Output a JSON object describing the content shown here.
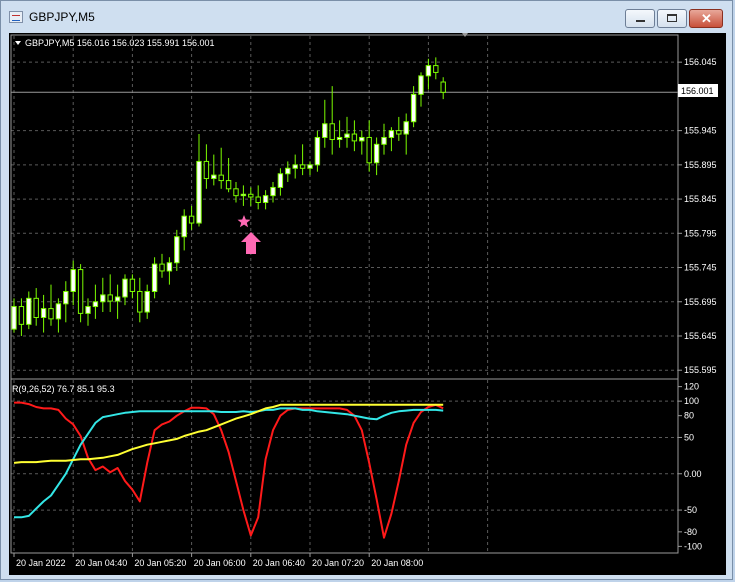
{
  "window": {
    "title": "GBPJPY,M5",
    "minimize_glyph": "–",
    "maximize_glyph": "□",
    "close_glyph": "✕"
  },
  "colors": {
    "background": "#000000",
    "grid": "#5a5a5a",
    "candle": "#7cfc00",
    "candle_body": "#ffffff",
    "line_red": "#ff1a1a",
    "line_cyan": "#33e6e6",
    "line_yellow": "#ffff33",
    "signal": "#ff69b4"
  },
  "price_panel": {
    "header": "GBPJPY,M5  156.016 156.023 155.991 156.001",
    "current_price_label": "156.001"
  },
  "indicator_panel": {
    "header": "R(9,26,52) 76.7 85.1 95.3"
  },
  "icons": {
    "signal_star": "star-icon",
    "buy_arrow": "arrow-up-icon",
    "menu": "triangle-down-icon"
  },
  "chart_data": [
    {
      "type": "candlestick",
      "title": "GBPJPY,M5",
      "ohlc_readout": [
        156.016,
        156.023,
        155.991,
        156.001
      ],
      "ylim": [
        155.588,
        156.073
      ],
      "yticks": [
        155.595,
        155.645,
        155.695,
        155.745,
        155.795,
        155.845,
        155.895,
        155.945,
        156.045
      ],
      "ytick_labels": [
        "155.595",
        "155.645",
        "155.695",
        "155.745",
        "155.795",
        "155.845",
        "155.895",
        "155.945",
        "156.045"
      ],
      "current_price": 156.001,
      "grid": true,
      "candles": [
        [
          155.655,
          155.7,
          155.65,
          155.688
        ],
        [
          155.688,
          155.7,
          155.645,
          155.662
        ],
        [
          155.662,
          155.71,
          155.655,
          155.7
        ],
        [
          155.7,
          155.715,
          155.66,
          155.672
        ],
        [
          155.672,
          155.705,
          155.65,
          155.685
        ],
        [
          155.685,
          155.72,
          155.66,
          155.67
        ],
        [
          155.67,
          155.7,
          155.65,
          155.692
        ],
        [
          155.692,
          155.725,
          155.665,
          155.71
        ],
        [
          155.71,
          155.755,
          155.69,
          155.742
        ],
        [
          155.742,
          155.75,
          155.665,
          155.678
        ],
        [
          155.678,
          155.7,
          155.66,
          155.688
        ],
        [
          155.688,
          155.72,
          155.67,
          155.695
        ],
        [
          155.695,
          155.73,
          155.68,
          155.705
        ],
        [
          155.705,
          155.735,
          155.68,
          155.696
        ],
        [
          155.696,
          155.72,
          155.67,
          155.702
        ],
        [
          155.702,
          155.735,
          155.69,
          155.728
        ],
        [
          155.728,
          155.735,
          155.7,
          155.71
        ],
        [
          155.71,
          155.73,
          155.665,
          155.68
        ],
        [
          155.68,
          155.72,
          155.67,
          155.71
        ],
        [
          155.71,
          155.76,
          155.7,
          155.75
        ],
        [
          155.75,
          155.765,
          155.73,
          155.74
        ],
        [
          155.74,
          155.76,
          155.72,
          155.752
        ],
        [
          155.752,
          155.8,
          155.74,
          155.79
        ],
        [
          155.79,
          155.83,
          155.77,
          155.82
        ],
        [
          155.82,
          155.835,
          155.8,
          155.81
        ],
        [
          155.81,
          155.94,
          155.805,
          155.9
        ],
        [
          155.9,
          155.925,
          155.86,
          155.875
        ],
        [
          155.875,
          155.91,
          155.865,
          155.88
        ],
        [
          155.88,
          155.92,
          155.86,
          155.872
        ],
        [
          155.872,
          155.905,
          155.855,
          155.86
        ],
        [
          155.86,
          155.87,
          155.84,
          155.85
        ],
        [
          155.85,
          155.865,
          155.835,
          155.852
        ],
        [
          155.852,
          155.862,
          155.835,
          155.848
        ],
        [
          155.848,
          155.865,
          155.83,
          155.84
        ],
        [
          155.84,
          155.858,
          155.83,
          155.85
        ],
        [
          155.85,
          155.87,
          155.84,
          155.862
        ],
        [
          155.862,
          155.89,
          155.85,
          155.882
        ],
        [
          155.882,
          155.9,
          155.87,
          155.89
        ],
        [
          155.89,
          155.91,
          155.875,
          155.895
        ],
        [
          155.895,
          155.925,
          155.88,
          155.89
        ],
        [
          155.89,
          155.9,
          155.88,
          155.895
        ],
        [
          155.895,
          155.945,
          155.885,
          155.935
        ],
        [
          155.935,
          155.99,
          155.92,
          155.955
        ],
        [
          155.955,
          156.01,
          155.91,
          155.932
        ],
        [
          155.932,
          155.96,
          155.92,
          155.935
        ],
        [
          155.935,
          155.965,
          155.92,
          155.94
        ],
        [
          155.94,
          155.96,
          155.915,
          155.93
        ],
        [
          155.93,
          155.945,
          155.91,
          155.935
        ],
        [
          155.935,
          155.96,
          155.885,
          155.898
        ],
        [
          155.898,
          155.935,
          155.88,
          155.925
        ],
        [
          155.925,
          155.955,
          155.91,
          155.935
        ],
        [
          155.935,
          155.95,
          155.915,
          155.945
        ],
        [
          155.945,
          155.965,
          155.93,
          155.94
        ],
        [
          155.94,
          155.97,
          155.91,
          155.958
        ],
        [
          155.958,
          156.01,
          155.95,
          155.998
        ],
        [
          155.998,
          156.03,
          155.98,
          156.025
        ],
        [
          156.025,
          156.05,
          156.005,
          156.04
        ],
        [
          156.04,
          156.052,
          156.02,
          156.03
        ],
        [
          156.016,
          156.023,
          155.991,
          156.001
        ]
      ]
    },
    {
      "type": "line",
      "title": "R(9,26,52)",
      "readout": [
        76.7,
        85.1,
        95.3
      ],
      "ylim": [
        -105,
        125
      ],
      "yticks": [
        120,
        100,
        80,
        50,
        0,
        -50,
        -80,
        -100
      ],
      "ytick_labels": [
        "120",
        "100",
        "80",
        "50",
        "0.00",
        "-50",
        "-80",
        "-100"
      ],
      "grid": true,
      "x_labels": [
        "20 Jan 2022",
        "20 Jan 04:40",
        "20 Jan 05:20",
        "20 Jan 06:00",
        "20 Jan 06:40",
        "20 Jan 07:20",
        "20 Jan 08:00"
      ],
      "x_label_index": [
        0,
        8,
        16,
        24,
        32,
        40,
        48
      ],
      "series": [
        {
          "color": "#ff1a1a",
          "values": [
            98,
            98,
            96,
            92,
            90,
            90,
            88,
            76,
            68,
            52,
            22,
            5,
            10,
            2,
            8,
            -10,
            -22,
            -38,
            15,
            60,
            68,
            72,
            80,
            86,
            91,
            91,
            90,
            82,
            60,
            30,
            -10,
            -50,
            -85,
            -60,
            20,
            60,
            80,
            88,
            90,
            90,
            90,
            90,
            90,
            90,
            90,
            88,
            80,
            60,
            15,
            -35,
            -88,
            -55,
            -10,
            40,
            70,
            85,
            92,
            95,
            90
          ]
        },
        {
          "color": "#33e6e6",
          "values": [
            -60,
            -60,
            -58,
            -48,
            -38,
            -30,
            -15,
            0,
            20,
            40,
            55,
            70,
            78,
            80,
            82,
            84,
            85,
            86,
            86,
            86,
            86,
            86,
            86,
            86,
            86,
            86,
            86,
            86,
            85,
            85,
            85,
            86,
            85,
            86,
            88,
            88,
            90,
            90,
            90,
            88,
            88,
            86,
            85,
            84,
            83,
            82,
            80,
            78,
            76,
            75,
            80,
            84,
            86,
            87,
            88,
            88,
            88,
            88,
            87
          ]
        },
        {
          "color": "#ffff33",
          "values": [
            15,
            16,
            16,
            16,
            17,
            18,
            18,
            18,
            19,
            20,
            20,
            21,
            22,
            24,
            26,
            30,
            34,
            37,
            40,
            42,
            44,
            46,
            48,
            52,
            55,
            58,
            60,
            64,
            68,
            72,
            76,
            79,
            82,
            86,
            90,
            92,
            95,
            95,
            95,
            95,
            95,
            95,
            95,
            95,
            95,
            95,
            95,
            95,
            95,
            95,
            95,
            95,
            95,
            95,
            95,
            95,
            95,
            95,
            95
          ]
        }
      ]
    }
  ]
}
